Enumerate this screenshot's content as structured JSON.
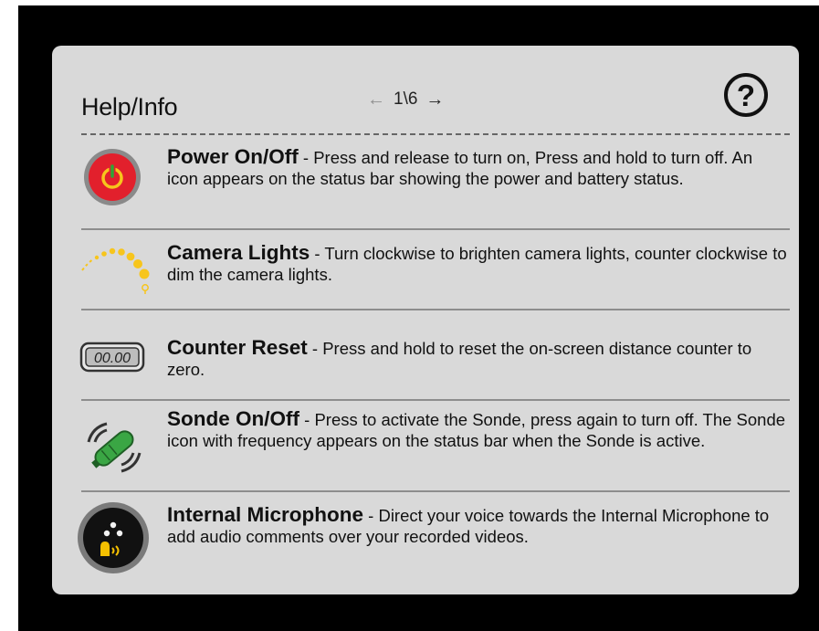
{
  "header": {
    "title": "Help/Info",
    "pager": {
      "prev_icon": "left-arrow",
      "page": "1\\6",
      "next_icon": "right-arrow"
    },
    "help_icon": "question-circle",
    "help_glyph": "?"
  },
  "items": [
    {
      "name": "Power On/Off",
      "description": " - Press and release to turn on, Press and hold to turn off. An icon appears on the status bar showing the power and battery status.",
      "icon": "power-icon"
    },
    {
      "name": "Camera Lights",
      "description": " - Turn clockwise to brighten camera lights, counter clockwise to dim the camera lights.",
      "icon": "camera-lights-icon"
    },
    {
      "name": "Counter Reset",
      "description": " - Press and hold to reset the on-screen distance counter to zero.",
      "icon": "counter-icon",
      "icon_text": "00.00"
    },
    {
      "name": "Sonde On/Off",
      "description": " - Press to activate the Sonde, press again to turn off. The Sonde icon with frequency appears on the status bar when the Sonde is active.",
      "icon": "sonde-icon"
    },
    {
      "name": "Internal Microphone",
      "description": " - Direct your voice towards the Internal Microphone to add audio comments over your recorded videos.",
      "icon": "microphone-icon"
    }
  ],
  "colors": {
    "panel": "#d9d9d9",
    "power_red": "#e2202c",
    "power_green": "#2fa536",
    "light_yellow": "#f7c51c",
    "sonde_green": "#3aa644",
    "mic_yellow": "#f5c000"
  }
}
